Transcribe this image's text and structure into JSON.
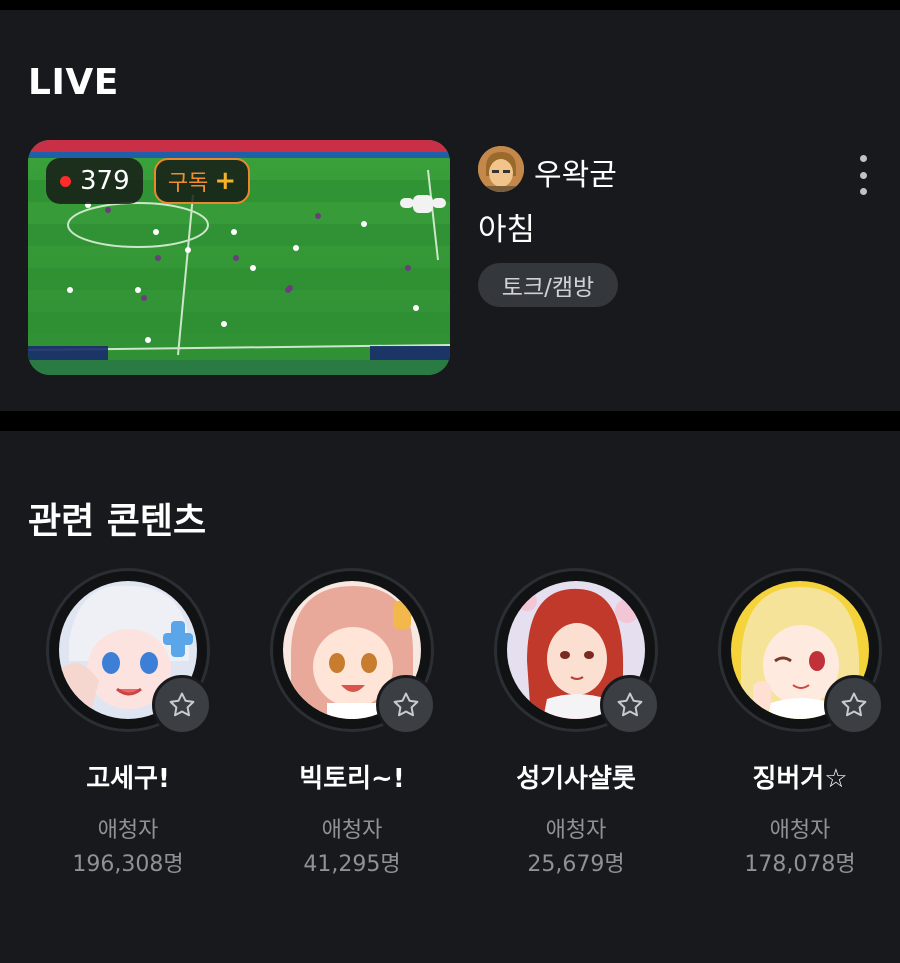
{
  "live": {
    "section_title": "LIVE",
    "viewer_count": "379",
    "subscribe_label": "구독",
    "subscribe_plus": "+",
    "streamer_name": "우왁굳",
    "stream_title": "아침",
    "category": "토크/캠방"
  },
  "related": {
    "section_title": "관련 콘텐츠",
    "channels": [
      {
        "name": "고세구!",
        "label": "애청자",
        "count": "196,308명"
      },
      {
        "name": "빅토리~!",
        "label": "애청자",
        "count": "41,295명"
      },
      {
        "name": "성기사샬롯",
        "label": "애청자",
        "count": "25,679명"
      },
      {
        "name": "징버거☆",
        "label": "애청자",
        "count": "178,078명"
      }
    ]
  },
  "colors": {
    "background": "#17191c",
    "live_dot": "#ff2a2a",
    "subscribe_accent": "#e88a2c",
    "muted_text": "#8e9297"
  },
  "icons": [
    "live-dot-icon",
    "plus-icon",
    "more-vertical-icon",
    "star-icon"
  ]
}
